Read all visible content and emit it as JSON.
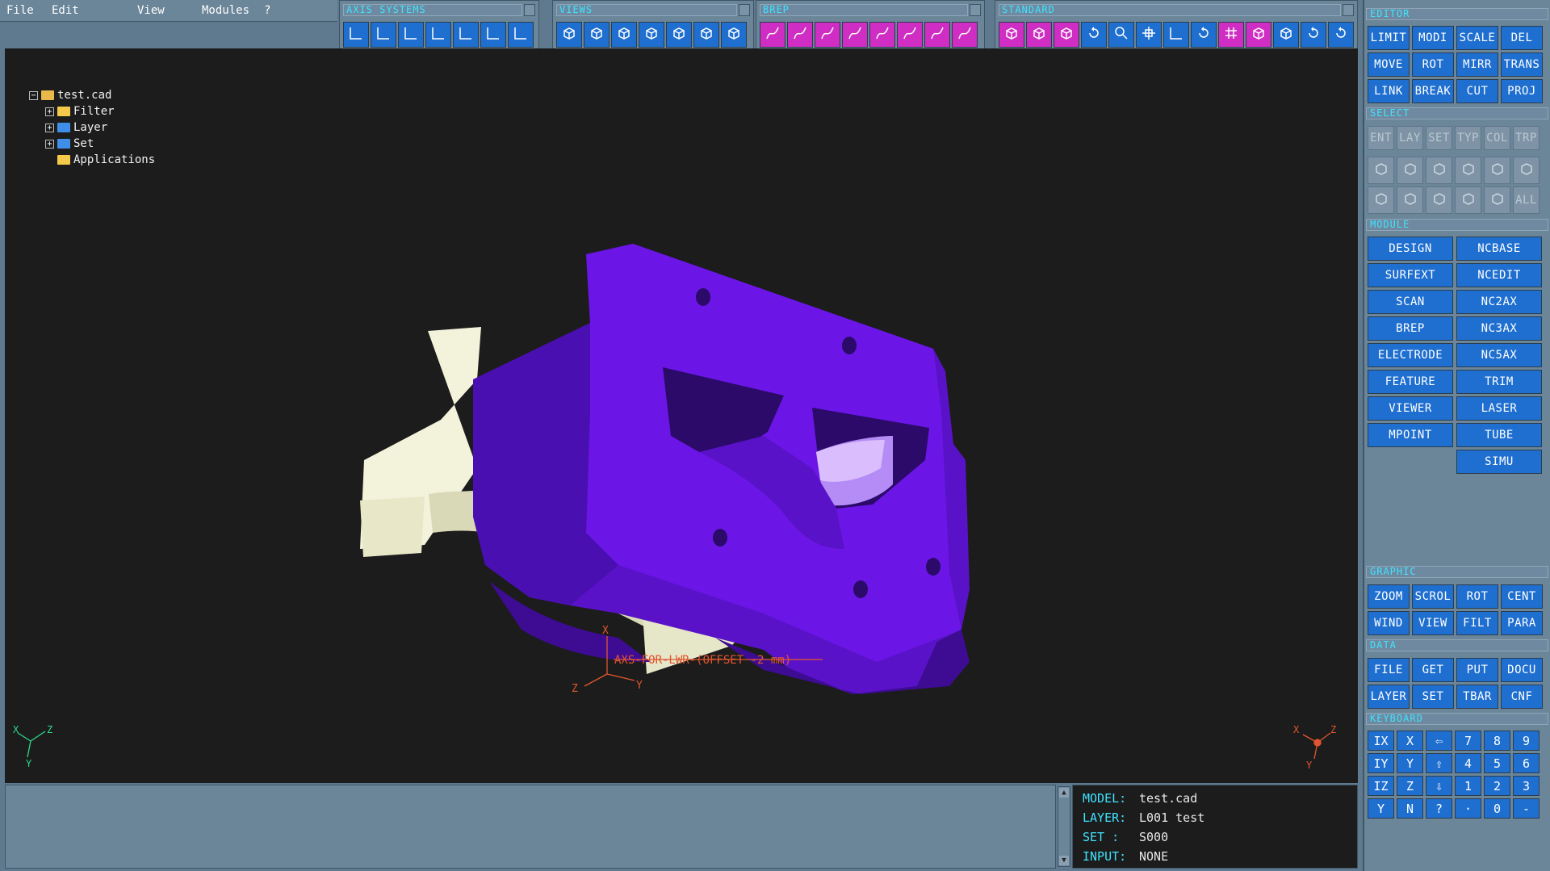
{
  "menu": [
    "File",
    "Edit",
    "View",
    "Modules",
    "?"
  ],
  "toolbars": {
    "axis": {
      "title": "AXIS SYSTEMS",
      "buttons": [
        "axis-yx-icon",
        "axis-zx-icon",
        "axis-xz-icon",
        "axis-xy-icon",
        "axis-yz-icon",
        "axis-zy-icon",
        "axis-default-icon"
      ]
    },
    "views": {
      "title": "VIEWS",
      "buttons": [
        "view-iso-1-icon",
        "view-iso-2-icon",
        "view-iso-3-icon",
        "view-iso-4-icon",
        "view-iso-5-icon",
        "view-iso-6-icon",
        "view-iso-7-icon"
      ]
    },
    "brep": {
      "title": "BREP",
      "buttons": [
        "brep-curve-1-icon",
        "brep-curve-2-icon",
        "brep-surface-1-icon",
        "brep-surface-2-icon",
        "brep-edit-1-icon",
        "brep-edit-2-icon",
        "brep-edit-3-icon",
        "brep-edit-4-icon"
      ]
    },
    "standard": {
      "title": "STANDARD",
      "buttons": [
        "wire-cube-icon",
        "shaded-cube-icon",
        "solid-cube-icon",
        "refresh-icon",
        "zoom-icon",
        "pan-icon",
        "axis-icon",
        "rotate-icon",
        "grid-icon",
        "frame-icon",
        "plane-icon",
        "undo-icon",
        "redo-icon"
      ],
      "active": [
        0,
        1,
        2,
        8,
        9
      ]
    }
  },
  "tree": {
    "root": "test.cad",
    "children": [
      "Filter",
      "Layer",
      "Set",
      "Applications"
    ]
  },
  "viewport": {
    "axis_label": "AXS-FOR-LWR-(OFFSET -2 mm)",
    "model_color": "#6b16e6",
    "insert_color": "#f3f3dc",
    "label_color": "#e0562e",
    "axis_letters": {
      "x": "X",
      "y": "Y",
      "z": "Z"
    }
  },
  "panel": {
    "editor": {
      "title": "EDITOR",
      "buttons": [
        "LIMIT",
        "MODI",
        "SCALE",
        "DEL",
        "MOVE",
        "ROT",
        "MIRR",
        "TRANS",
        "LINK",
        "BREAK",
        "CUT",
        "PROJ"
      ]
    },
    "select": {
      "title": "SELECT",
      "buttons": [
        "ENT",
        "LAY",
        "SET",
        "TYP",
        "COL",
        "TRP"
      ],
      "icons": [
        "point-icon",
        "curve-icon",
        "surface-icon",
        "face-icon",
        "solid-icon",
        "body-icon",
        "plane-sel-icon",
        "axis-sel-icon",
        "dim-icon",
        "mesh-icon",
        "group-icon"
      ],
      "all": "ALL"
    },
    "module": {
      "title": "MODULE",
      "left": [
        "DESIGN",
        "SURFEXT",
        "SCAN",
        "BREP",
        "ELECTRODE",
        "FEATURE",
        "VIEWER",
        "MPOINT"
      ],
      "right": [
        "NCBASE",
        "NCEDIT",
        "NC2AX",
        "NC3AX",
        "NC5AX",
        "TRIM",
        "LASER",
        "TUBE",
        "SIMU"
      ]
    },
    "graphic": {
      "title": "GRAPHIC",
      "buttons": [
        "ZOOM",
        "SCROL",
        "ROT",
        "CENT",
        "WIND",
        "VIEW",
        "FILT",
        "PARA"
      ]
    },
    "data": {
      "title": "DATA",
      "buttons": [
        "FILE",
        "GET",
        "PUT",
        "DOCU",
        "LAYER",
        "SET",
        "TBAR",
        "CNF"
      ]
    },
    "keyboard": {
      "title": "KEYBOARD",
      "keys": [
        "IX",
        "X",
        "⇦",
        "7",
        "8",
        "9",
        "IY",
        "Y",
        "⇧",
        "4",
        "5",
        "6",
        "IZ",
        "Z",
        "⇩",
        "1",
        "2",
        "3",
        "Y",
        "N",
        "?",
        "·",
        "0",
        "-"
      ]
    }
  },
  "info": {
    "model_label": "MODEL:",
    "model": "test.cad",
    "layer_label": "LAYER:",
    "layer": "L001 test",
    "set_label": "SET  :",
    "set": "S000",
    "input_label": "INPUT:",
    "input": "NONE"
  }
}
